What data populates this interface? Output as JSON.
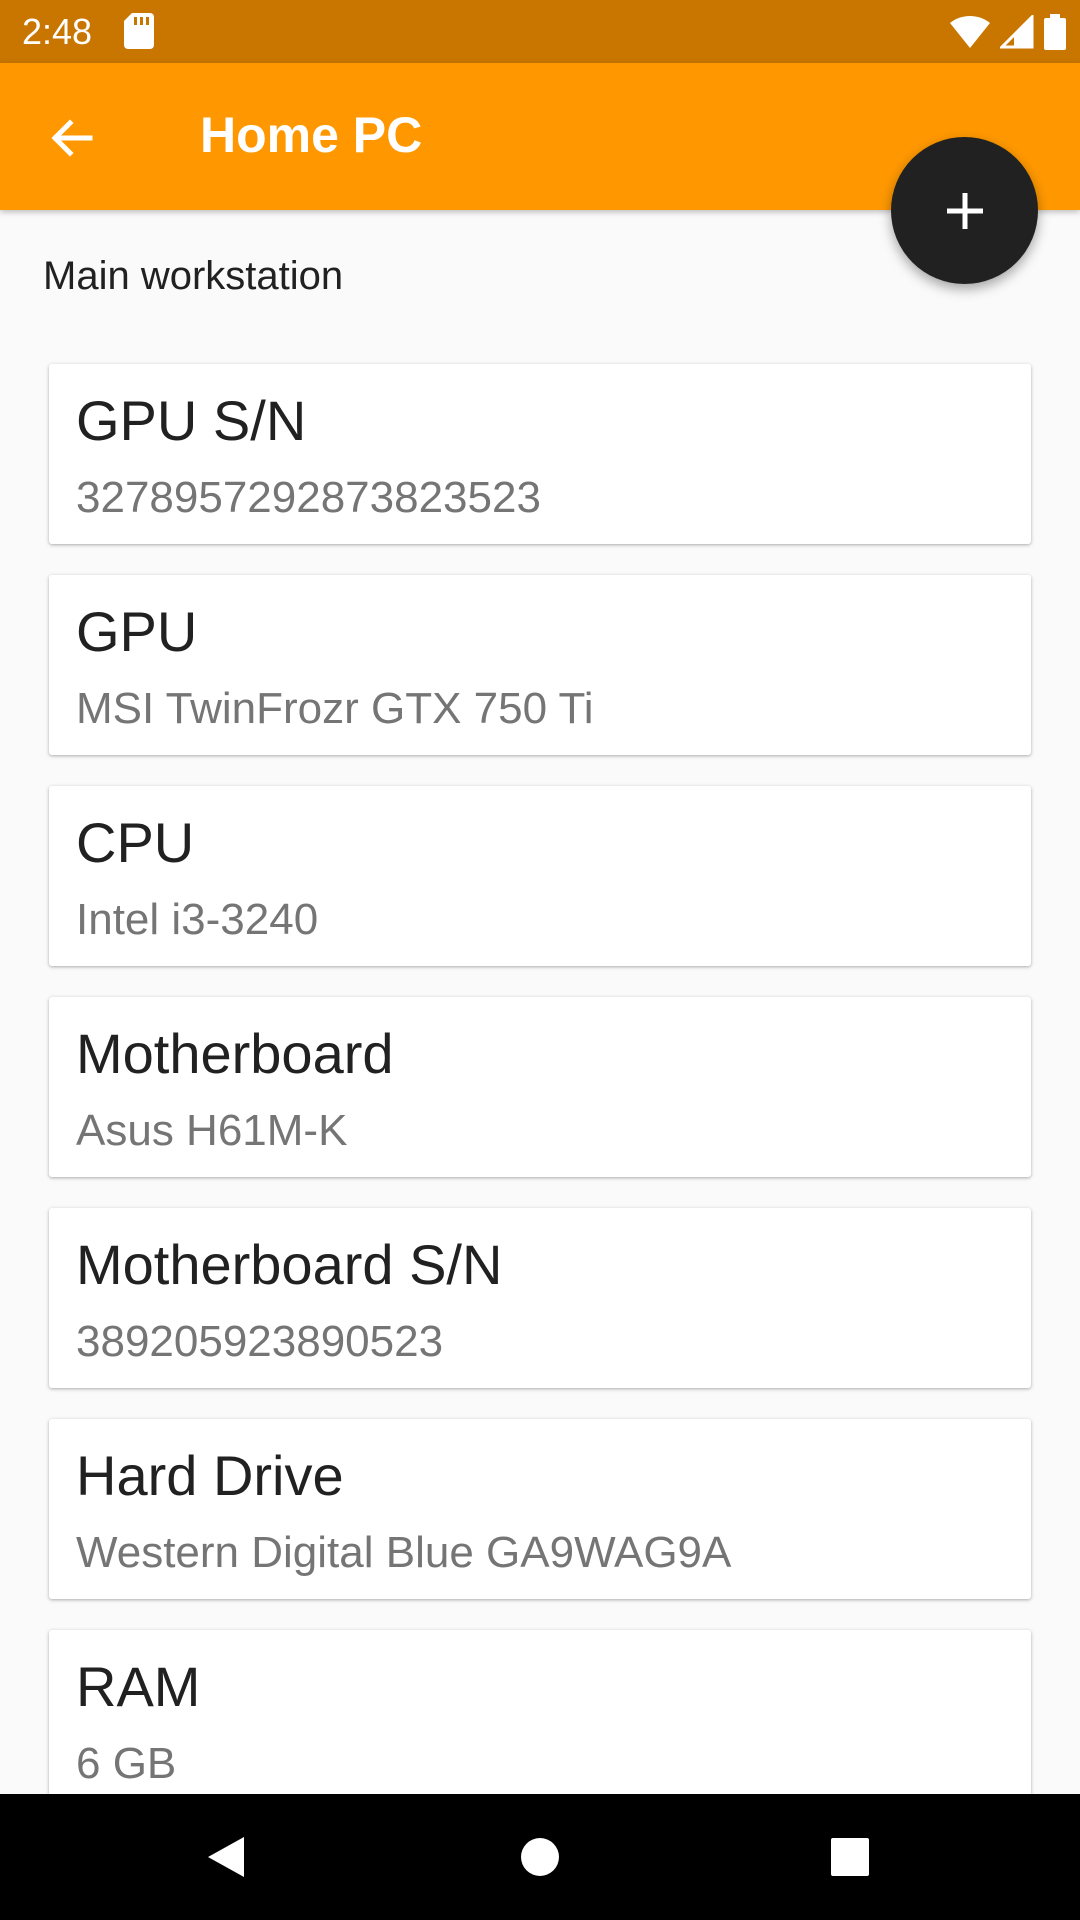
{
  "status_bar": {
    "time": "2:48",
    "icons": [
      "sd-card-icon",
      "wifi-icon",
      "cell-signal-icon",
      "battery-icon"
    ]
  },
  "app_bar": {
    "title": "Home PC",
    "back_icon": "arrow-back-icon",
    "color": "#ff9800"
  },
  "fab": {
    "icon": "plus-icon",
    "color": "#212121"
  },
  "description": "Main workstation",
  "items": [
    {
      "title": "GPU S/N",
      "value": "3278957292873823523"
    },
    {
      "title": "GPU",
      "value": "MSI TwinFrozr GTX 750 Ti"
    },
    {
      "title": "CPU",
      "value": "Intel i3-3240"
    },
    {
      "title": "Motherboard",
      "value": "Asus H61M-K"
    },
    {
      "title": "Motherboard S/N",
      "value": "389205923890523"
    },
    {
      "title": "Hard Drive",
      "value": "Western Digital Blue GA9WAG9A"
    },
    {
      "title": "RAM",
      "value": "6 GB"
    }
  ],
  "nav_bar": {
    "icons": [
      "nav-back-icon",
      "nav-home-icon",
      "nav-recents-icon"
    ]
  }
}
